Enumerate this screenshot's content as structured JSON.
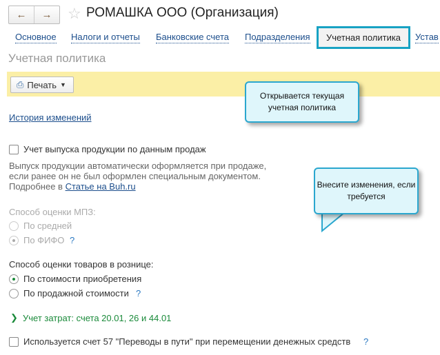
{
  "window": {
    "title": "РОМАШКА ООО (Организация)"
  },
  "tabs": [
    {
      "label": "Основное"
    },
    {
      "label": "Налоги и отчеты"
    },
    {
      "label": "Банковские счета"
    },
    {
      "label": "Подразделения"
    },
    {
      "label": "Учетная политика",
      "active": true
    },
    {
      "label": "Устав"
    }
  ],
  "section_title": "Учетная политика",
  "toolbar": {
    "print_label": "Печать"
  },
  "callouts": [
    "Открывается текущая учетная политика",
    "Внесите изменения, если требуется"
  ],
  "history_link": "История изменений",
  "production_checkbox": {
    "label": "Учет выпуска продукции по данным продаж",
    "checked": false
  },
  "description": {
    "line1": "Выпуск продукции автоматически оформляется при продаже,",
    "line2": "если ранее он не был оформлен специальным документом.",
    "line3_prefix": "Подробнее в ",
    "link": "Статье на Buh.ru"
  },
  "mpz": {
    "label": "Способ оценки МПЗ:",
    "options": [
      "По средней",
      "По ФИФО"
    ],
    "selected": "По ФИФО",
    "disabled": true
  },
  "retail": {
    "label": "Способ оценки товаров в рознице:",
    "options": [
      "По стоимости приобретения",
      "По продажной стоимости"
    ],
    "selected": "По стоимости приобретения"
  },
  "costs_link": "Учет затрат: счета 20.01, 26 и 44.01",
  "account57_checkbox": {
    "label": "Используется счет 57 \"Переводы в пути\" при перемещении денежных средств",
    "checked": false
  },
  "help": "?",
  "colors": {
    "accent": "#17a2c3",
    "link": "#1c4e8c",
    "green": "#1a8a3a",
    "yellow_bar": "#fbefa6"
  }
}
